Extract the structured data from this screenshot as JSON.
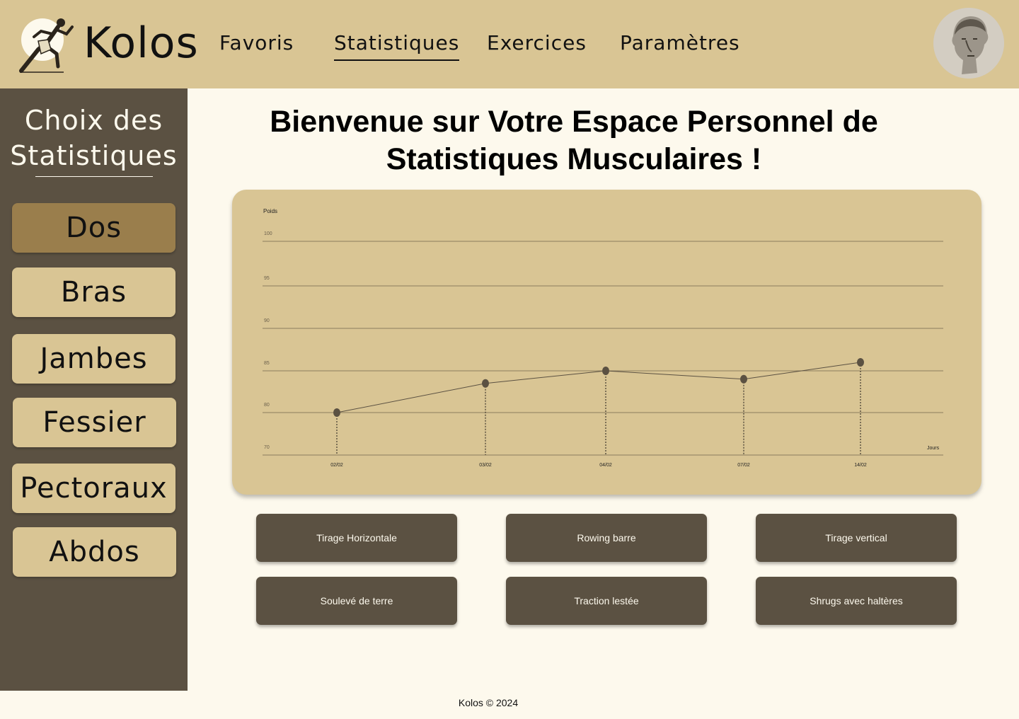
{
  "header": {
    "brand": "Kolos",
    "nav": [
      {
        "label": "Favoris",
        "active": false
      },
      {
        "label": "Statistiques",
        "active": true
      },
      {
        "label": "Exercices",
        "active": false
      },
      {
        "label": "Paramètres",
        "active": false
      }
    ]
  },
  "sidebar": {
    "title_line1": "Choix des",
    "title_line2": "Statistiques",
    "items": [
      {
        "label": "Dos",
        "active": true
      },
      {
        "label": "Bras",
        "active": false
      },
      {
        "label": "Jambes",
        "active": false
      },
      {
        "label": "Fessier",
        "active": false
      },
      {
        "label": "Pectoraux",
        "active": false
      },
      {
        "label": "Abdos",
        "active": false
      }
    ]
  },
  "main": {
    "title_line1": "Bienvenue sur Votre Espace Personnel de",
    "title_line2": "Statistiques Musculaires !"
  },
  "chart_data": {
    "type": "line",
    "ylabel": "Poids",
    "xlabel": "Jours",
    "yticks": [
      70,
      80,
      85,
      90,
      95,
      100
    ],
    "x": [
      "02/02",
      "03/02",
      "04/02",
      "07/02",
      "14/02"
    ],
    "values": [
      80,
      83.5,
      85,
      84,
      86
    ],
    "grid": true,
    "line_color": "#5b5142"
  },
  "exercises": [
    "Tirage Horizontale",
    "Rowing barre",
    "Tirage vertical",
    "Soulevé de terre",
    "Traction lestée",
    "Shrugs avec haltères"
  ],
  "footer": {
    "text": "Kolos © 2024"
  },
  "colors": {
    "header_bg": "#d9c594",
    "sidebar_bg": "#5b5142",
    "active_category": "#9a7e4c",
    "page_bg": "#fdf9ed"
  }
}
